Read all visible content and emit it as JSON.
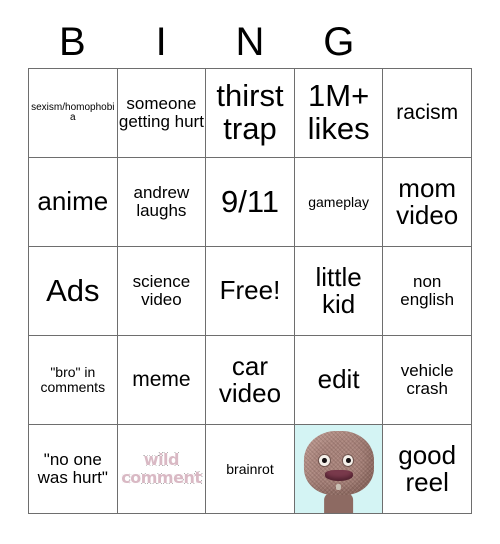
{
  "card": {
    "title": "BINGO",
    "header_letters": [
      "B",
      "I",
      "N",
      "G",
      ""
    ],
    "grid_size": "5x5",
    "colors": {
      "background": "#ffffff",
      "grid_line": "#6e6e6e",
      "text": "#000000",
      "image_cell_background": "#d4f4f4",
      "bubble_text_fill": "#d9b9c4",
      "bubble_text_outline": "#1a1a1a"
    },
    "rows": [
      [
        {
          "text": "sexism/homophobia",
          "size": "xxs",
          "style": "text"
        },
        {
          "text": "someone getting hurt",
          "size": "s",
          "style": "text"
        },
        {
          "text": "thirst trap",
          "size": "xl",
          "style": "text"
        },
        {
          "text": "1M+ likes",
          "size": "xl",
          "style": "text"
        },
        {
          "text": "racism",
          "size": "m",
          "style": "text"
        }
      ],
      [
        {
          "text": "anime",
          "size": "l",
          "style": "text"
        },
        {
          "text": "andrew laughs",
          "size": "s",
          "style": "text"
        },
        {
          "text": "9/11",
          "size": "xl",
          "style": "text"
        },
        {
          "text": "gameplay",
          "size": "xs",
          "style": "text"
        },
        {
          "text": "mom video",
          "size": "l",
          "style": "text"
        }
      ],
      [
        {
          "text": "Ads",
          "size": "xl",
          "style": "text"
        },
        {
          "text": "science video",
          "size": "s",
          "style": "text"
        },
        {
          "text": "Free!",
          "size": "l",
          "style": "text"
        },
        {
          "text": "little kid",
          "size": "l",
          "style": "text"
        },
        {
          "text": "non english",
          "size": "s",
          "style": "text"
        }
      ],
      [
        {
          "text": "\"bro\" in comments",
          "size": "xs",
          "style": "text"
        },
        {
          "text": "meme",
          "size": "m",
          "style": "text"
        },
        {
          "text": "car video",
          "size": "l",
          "style": "text"
        },
        {
          "text": "edit",
          "size": "l",
          "style": "text"
        },
        {
          "text": "vehicle crash",
          "size": "s",
          "style": "text"
        }
      ],
      [
        {
          "text": "\"no one was hurt\"",
          "size": "s",
          "style": "text"
        },
        {
          "text": "wild comment",
          "size": "xs",
          "style": "bubble"
        },
        {
          "text": "brainrot",
          "size": "xs",
          "style": "text"
        },
        {
          "text": "",
          "size": "xs",
          "style": "image",
          "image": "sackboy-character"
        },
        {
          "text": "good reel",
          "size": "l",
          "style": "text"
        }
      ]
    ]
  }
}
